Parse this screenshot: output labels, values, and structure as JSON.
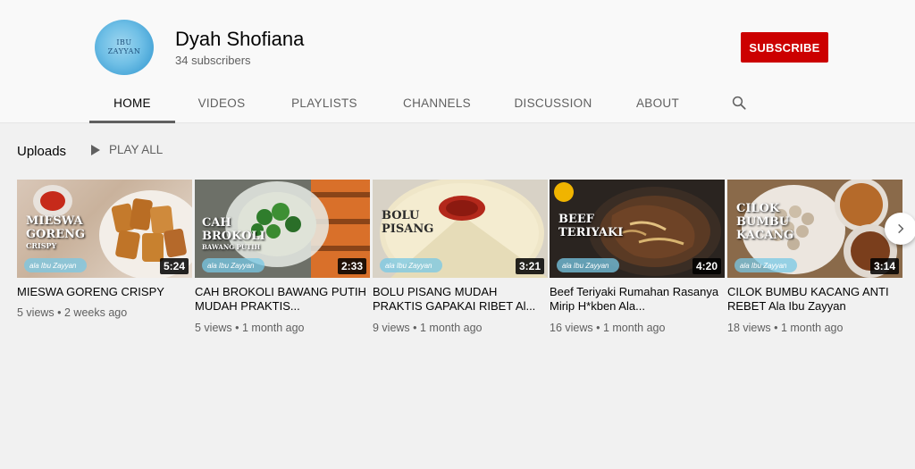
{
  "channel": {
    "avatar_text_1": "IBU",
    "avatar_text_2": "ZAYYAN",
    "name": "Dyah Shofiana",
    "subscribers": "34 subscribers",
    "subscribe_label": "SUBSCRIBE"
  },
  "tabs": [
    {
      "label": "HOME",
      "active": true
    },
    {
      "label": "VIDEOS"
    },
    {
      "label": "PLAYLISTS"
    },
    {
      "label": "CHANNELS"
    },
    {
      "label": "DISCUSSION"
    },
    {
      "label": "ABOUT"
    }
  ],
  "uploads": {
    "title": "Uploads",
    "play_all": "PLAY ALL"
  },
  "videos": [
    {
      "thumb_lines": [
        "MIESWA",
        "GORENG"
      ],
      "thumb_sub": "CRISPY",
      "watermark": "ala Ibu Zayyan",
      "duration": "5:24",
      "title": "MIESWA GORENG CRISPY",
      "meta": "5 views • 2 weeks ago"
    },
    {
      "thumb_lines": [
        "CAH",
        "BROKOLI"
      ],
      "thumb_sub": "BAWANG PUTIH",
      "watermark": "ala Ibu Zayyan",
      "duration": "2:33",
      "title": "CAH BROKOLI BAWANG PUTIH MUDAH PRAKTIS...",
      "meta": "5 views • 1 month ago"
    },
    {
      "thumb_lines": [
        "BOLU",
        "PISANG"
      ],
      "thumb_sub": "",
      "watermark": "ala Ibu Zayyan",
      "duration": "3:21",
      "title": "BOLU PISANG MUDAH PRAKTIS GAPAKAI RIBET Al...",
      "meta": "9 views • 1 month ago"
    },
    {
      "thumb_lines": [
        "BEEF",
        "TERIYAKI"
      ],
      "thumb_sub": "",
      "watermark": "ala Ibu Zayyan",
      "duration": "4:20",
      "title": "Beef Teriyaki Rumahan Rasanya Mirip H*kben Ala...",
      "meta": "16 views • 1 month ago"
    },
    {
      "thumb_lines": [
        "CILOK",
        "BUMBU",
        "KACANG"
      ],
      "thumb_sub": "",
      "watermark": "ala Ibu Zayyan",
      "duration": "3:14",
      "title": "CILOK BUMBU KACANG ANTI REBET Ala Ibu Zayyan",
      "meta": "18 views • 1 month ago"
    }
  ],
  "colors": {
    "subscribe": "#cc0000",
    "text_secondary": "#606060",
    "background": "#f1f1f1"
  }
}
